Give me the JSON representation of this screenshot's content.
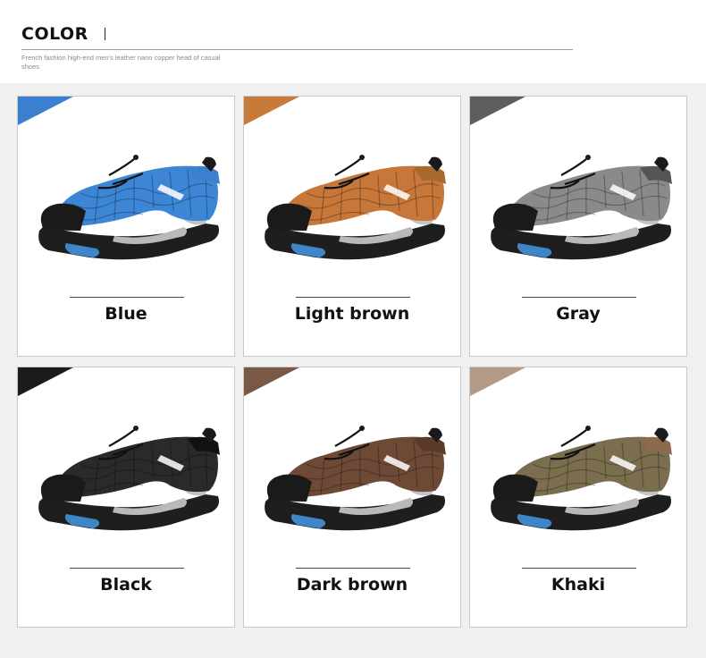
{
  "header": {
    "title": "COLOR",
    "subtitle": "French fashion high-end men's leather nano copper head of casual shoes"
  },
  "colors": [
    {
      "label": "Blue",
      "swatch": "#3a7fd0",
      "mesh": "#3d86d6",
      "trim": "#3a7fd0"
    },
    {
      "label": "Light brown",
      "swatch": "#c77b3b",
      "mesh": "#c7773a",
      "trim": "#a8682e"
    },
    {
      "label": "Gray",
      "swatch": "#5e5e5e",
      "mesh": "#8a8a8a",
      "trim": "#555555"
    },
    {
      "label": "Black",
      "swatch": "#1b1b1b",
      "mesh": "#2a2a2a",
      "trim": "#111111"
    },
    {
      "label": "Dark brown",
      "swatch": "#7a5846",
      "mesh": "#6e4a36",
      "trim": "#5a3b2a"
    },
    {
      "label": "Khaki",
      "swatch": "#b39a87",
      "mesh": "#7b6e4e",
      "trim": "#8c6a4e"
    }
  ]
}
